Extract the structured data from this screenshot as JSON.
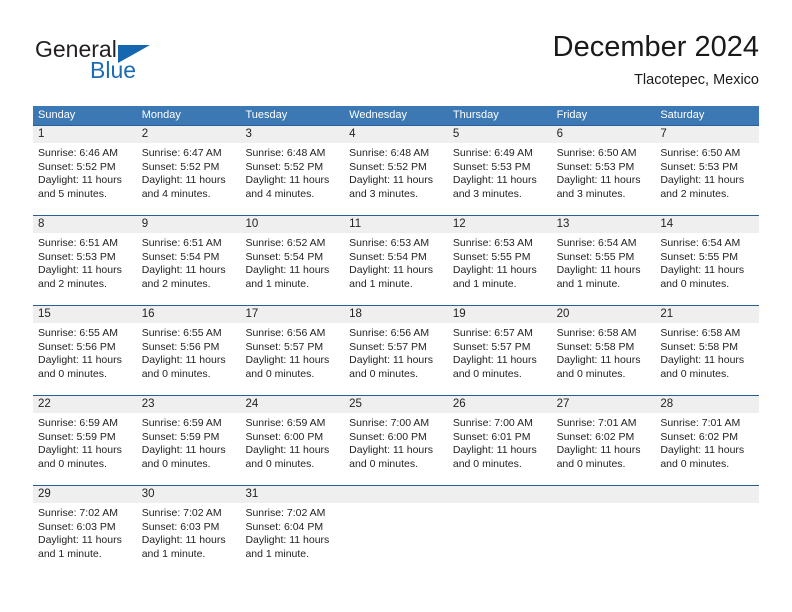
{
  "brand": {
    "name_part1": "General",
    "name_part2": "Blue",
    "accent_color": "#1567b0"
  },
  "header": {
    "title": "December 2024",
    "subtitle": "Tlacotepec, Mexico"
  },
  "calendar": {
    "header_color": "#3c78b4",
    "weekdays": [
      "Sunday",
      "Monday",
      "Tuesday",
      "Wednesday",
      "Thursday",
      "Friday",
      "Saturday"
    ],
    "weeks": [
      {
        "days": [
          {
            "date": "1",
            "sunrise": "Sunrise: 6:46 AM",
            "sunset": "Sunset: 5:52 PM",
            "daylight_line1": "Daylight: 11 hours",
            "daylight_line2": "and 5 minutes."
          },
          {
            "date": "2",
            "sunrise": "Sunrise: 6:47 AM",
            "sunset": "Sunset: 5:52 PM",
            "daylight_line1": "Daylight: 11 hours",
            "daylight_line2": "and 4 minutes."
          },
          {
            "date": "3",
            "sunrise": "Sunrise: 6:48 AM",
            "sunset": "Sunset: 5:52 PM",
            "daylight_line1": "Daylight: 11 hours",
            "daylight_line2": "and 4 minutes."
          },
          {
            "date": "4",
            "sunrise": "Sunrise: 6:48 AM",
            "sunset": "Sunset: 5:52 PM",
            "daylight_line1": "Daylight: 11 hours",
            "daylight_line2": "and 3 minutes."
          },
          {
            "date": "5",
            "sunrise": "Sunrise: 6:49 AM",
            "sunset": "Sunset: 5:53 PM",
            "daylight_line1": "Daylight: 11 hours",
            "daylight_line2": "and 3 minutes."
          },
          {
            "date": "6",
            "sunrise": "Sunrise: 6:50 AM",
            "sunset": "Sunset: 5:53 PM",
            "daylight_line1": "Daylight: 11 hours",
            "daylight_line2": "and 3 minutes."
          },
          {
            "date": "7",
            "sunrise": "Sunrise: 6:50 AM",
            "sunset": "Sunset: 5:53 PM",
            "daylight_line1": "Daylight: 11 hours",
            "daylight_line2": "and 2 minutes."
          }
        ]
      },
      {
        "days": [
          {
            "date": "8",
            "sunrise": "Sunrise: 6:51 AM",
            "sunset": "Sunset: 5:53 PM",
            "daylight_line1": "Daylight: 11 hours",
            "daylight_line2": "and 2 minutes."
          },
          {
            "date": "9",
            "sunrise": "Sunrise: 6:51 AM",
            "sunset": "Sunset: 5:54 PM",
            "daylight_line1": "Daylight: 11 hours",
            "daylight_line2": "and 2 minutes."
          },
          {
            "date": "10",
            "sunrise": "Sunrise: 6:52 AM",
            "sunset": "Sunset: 5:54 PM",
            "daylight_line1": "Daylight: 11 hours",
            "daylight_line2": "and 1 minute."
          },
          {
            "date": "11",
            "sunrise": "Sunrise: 6:53 AM",
            "sunset": "Sunset: 5:54 PM",
            "daylight_line1": "Daylight: 11 hours",
            "daylight_line2": "and 1 minute."
          },
          {
            "date": "12",
            "sunrise": "Sunrise: 6:53 AM",
            "sunset": "Sunset: 5:55 PM",
            "daylight_line1": "Daylight: 11 hours",
            "daylight_line2": "and 1 minute."
          },
          {
            "date": "13",
            "sunrise": "Sunrise: 6:54 AM",
            "sunset": "Sunset: 5:55 PM",
            "daylight_line1": "Daylight: 11 hours",
            "daylight_line2": "and 1 minute."
          },
          {
            "date": "14",
            "sunrise": "Sunrise: 6:54 AM",
            "sunset": "Sunset: 5:55 PM",
            "daylight_line1": "Daylight: 11 hours",
            "daylight_line2": "and 0 minutes."
          }
        ]
      },
      {
        "days": [
          {
            "date": "15",
            "sunrise": "Sunrise: 6:55 AM",
            "sunset": "Sunset: 5:56 PM",
            "daylight_line1": "Daylight: 11 hours",
            "daylight_line2": "and 0 minutes."
          },
          {
            "date": "16",
            "sunrise": "Sunrise: 6:55 AM",
            "sunset": "Sunset: 5:56 PM",
            "daylight_line1": "Daylight: 11 hours",
            "daylight_line2": "and 0 minutes."
          },
          {
            "date": "17",
            "sunrise": "Sunrise: 6:56 AM",
            "sunset": "Sunset: 5:57 PM",
            "daylight_line1": "Daylight: 11 hours",
            "daylight_line2": "and 0 minutes."
          },
          {
            "date": "18",
            "sunrise": "Sunrise: 6:56 AM",
            "sunset": "Sunset: 5:57 PM",
            "daylight_line1": "Daylight: 11 hours",
            "daylight_line2": "and 0 minutes."
          },
          {
            "date": "19",
            "sunrise": "Sunrise: 6:57 AM",
            "sunset": "Sunset: 5:57 PM",
            "daylight_line1": "Daylight: 11 hours",
            "daylight_line2": "and 0 minutes."
          },
          {
            "date": "20",
            "sunrise": "Sunrise: 6:58 AM",
            "sunset": "Sunset: 5:58 PM",
            "daylight_line1": "Daylight: 11 hours",
            "daylight_line2": "and 0 minutes."
          },
          {
            "date": "21",
            "sunrise": "Sunrise: 6:58 AM",
            "sunset": "Sunset: 5:58 PM",
            "daylight_line1": "Daylight: 11 hours",
            "daylight_line2": "and 0 minutes."
          }
        ]
      },
      {
        "days": [
          {
            "date": "22",
            "sunrise": "Sunrise: 6:59 AM",
            "sunset": "Sunset: 5:59 PM",
            "daylight_line1": "Daylight: 11 hours",
            "daylight_line2": "and 0 minutes."
          },
          {
            "date": "23",
            "sunrise": "Sunrise: 6:59 AM",
            "sunset": "Sunset: 5:59 PM",
            "daylight_line1": "Daylight: 11 hours",
            "daylight_line2": "and 0 minutes."
          },
          {
            "date": "24",
            "sunrise": "Sunrise: 6:59 AM",
            "sunset": "Sunset: 6:00 PM",
            "daylight_line1": "Daylight: 11 hours",
            "daylight_line2": "and 0 minutes."
          },
          {
            "date": "25",
            "sunrise": "Sunrise: 7:00 AM",
            "sunset": "Sunset: 6:00 PM",
            "daylight_line1": "Daylight: 11 hours",
            "daylight_line2": "and 0 minutes."
          },
          {
            "date": "26",
            "sunrise": "Sunrise: 7:00 AM",
            "sunset": "Sunset: 6:01 PM",
            "daylight_line1": "Daylight: 11 hours",
            "daylight_line2": "and 0 minutes."
          },
          {
            "date": "27",
            "sunrise": "Sunrise: 7:01 AM",
            "sunset": "Sunset: 6:02 PM",
            "daylight_line1": "Daylight: 11 hours",
            "daylight_line2": "and 0 minutes."
          },
          {
            "date": "28",
            "sunrise": "Sunrise: 7:01 AM",
            "sunset": "Sunset: 6:02 PM",
            "daylight_line1": "Daylight: 11 hours",
            "daylight_line2": "and 0 minutes."
          }
        ]
      },
      {
        "days": [
          {
            "date": "29",
            "sunrise": "Sunrise: 7:02 AM",
            "sunset": "Sunset: 6:03 PM",
            "daylight_line1": "Daylight: 11 hours",
            "daylight_line2": "and 1 minute."
          },
          {
            "date": "30",
            "sunrise": "Sunrise: 7:02 AM",
            "sunset": "Sunset: 6:03 PM",
            "daylight_line1": "Daylight: 11 hours",
            "daylight_line2": "and 1 minute."
          },
          {
            "date": "31",
            "sunrise": "Sunrise: 7:02 AM",
            "sunset": "Sunset: 6:04 PM",
            "daylight_line1": "Daylight: 11 hours",
            "daylight_line2": "and 1 minute."
          },
          {
            "date": "",
            "sunrise": "",
            "sunset": "",
            "daylight_line1": "",
            "daylight_line2": ""
          },
          {
            "date": "",
            "sunrise": "",
            "sunset": "",
            "daylight_line1": "",
            "daylight_line2": ""
          },
          {
            "date": "",
            "sunrise": "",
            "sunset": "",
            "daylight_line1": "",
            "daylight_line2": ""
          },
          {
            "date": "",
            "sunrise": "",
            "sunset": "",
            "daylight_line1": "",
            "daylight_line2": ""
          }
        ]
      }
    ]
  }
}
